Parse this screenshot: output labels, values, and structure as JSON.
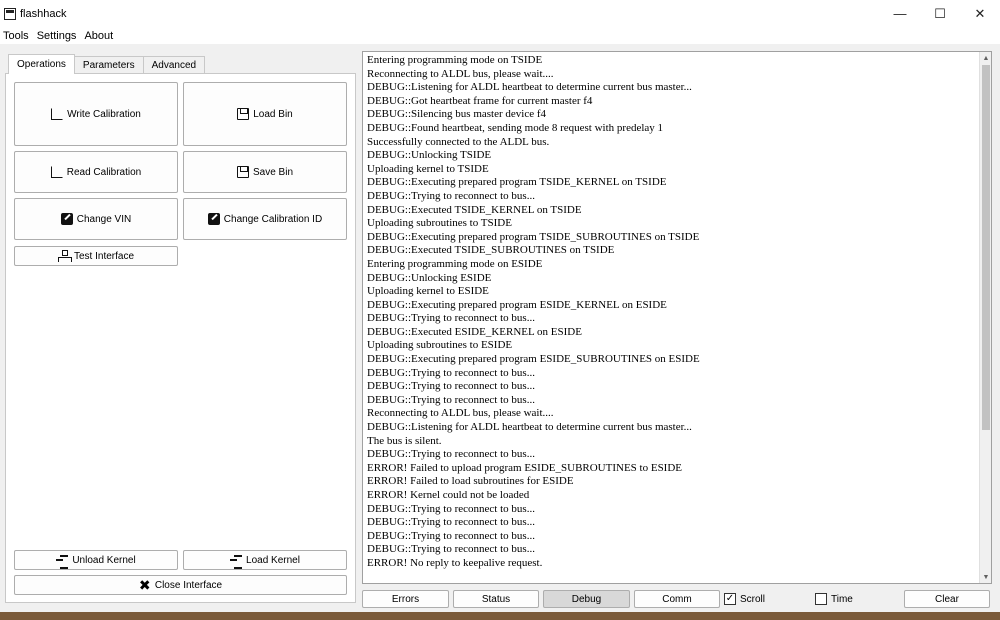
{
  "window": {
    "title": "flashhack",
    "controls": {
      "minimize": "—",
      "maximize": "☐",
      "close": "✕"
    }
  },
  "menu": [
    "Tools",
    "Settings",
    "About"
  ],
  "tabs": [
    {
      "label": "Operations",
      "active": true
    },
    {
      "label": "Parameters",
      "active": false
    },
    {
      "label": "Advanced",
      "active": false
    }
  ],
  "operations": {
    "write_calibration": "Write Calibration",
    "load_bin": "Load Bin",
    "read_calibration": "Read Calibration",
    "save_bin": "Save Bin",
    "change_vin": "Change VIN",
    "change_calibration_id": "Change Calibration ID",
    "test_interface": "Test Interface",
    "unload_kernel": "Unload Kernel",
    "load_kernel": "Load Kernel",
    "close_interface": "Close Interface"
  },
  "log": [
    "Entering programming mode on TSIDE",
    "Reconnecting to ALDL bus, please wait....",
    "DEBUG::Listening for ALDL heartbeat to determine current bus master...",
    "DEBUG::Got heartbeat frame for current master f4",
    "DEBUG::Silencing bus master device f4",
    "DEBUG::Found heartbeat, sending mode 8 request with predelay 1",
    "Successfully connected to the ALDL bus.",
    "DEBUG::Unlocking TSIDE",
    "Uploading kernel to TSIDE",
    "DEBUG::Executing prepared program TSIDE_KERNEL on TSIDE",
    "DEBUG::Trying to reconnect to bus...",
    "DEBUG::Executed TSIDE_KERNEL on TSIDE",
    "Uploading subroutines to TSIDE",
    "DEBUG::Executing prepared program TSIDE_SUBROUTINES on TSIDE",
    "DEBUG::Executed TSIDE_SUBROUTINES on TSIDE",
    "Entering programming mode on ESIDE",
    "DEBUG::Unlocking ESIDE",
    "Uploading kernel to ESIDE",
    "DEBUG::Executing prepared program ESIDE_KERNEL on ESIDE",
    "DEBUG::Trying to reconnect to bus...",
    "DEBUG::Executed ESIDE_KERNEL on ESIDE",
    "Uploading subroutines to ESIDE",
    "DEBUG::Executing prepared program ESIDE_SUBROUTINES on ESIDE",
    "DEBUG::Trying to reconnect to bus...",
    "DEBUG::Trying to reconnect to bus...",
    "DEBUG::Trying to reconnect to bus...",
    "Reconnecting to ALDL bus, please wait....",
    "DEBUG::Listening for ALDL heartbeat to determine current bus master...",
    "The bus is silent.",
    "DEBUG::Trying to reconnect to bus...",
    "ERROR! Failed to upload program ESIDE_SUBROUTINES to ESIDE",
    "ERROR! Failed to load subroutines for ESIDE",
    "ERROR! Kernel could not be loaded",
    "DEBUG::Trying to reconnect to bus...",
    "DEBUG::Trying to reconnect to bus...",
    "DEBUG::Trying to reconnect to bus...",
    "DEBUG::Trying to reconnect to bus...",
    "ERROR! No reply to keepalive request."
  ],
  "bottom": {
    "errors": "Errors",
    "status": "Status",
    "debug": "Debug",
    "comm": "Comm",
    "scroll": {
      "label": "Scroll",
      "checked": true
    },
    "time": {
      "label": "Time",
      "checked": false
    },
    "clear": "Clear"
  },
  "icons": {
    "write_calibration": "box-arrow-in-icon",
    "read_calibration": "box-arrow-out-icon",
    "load_bin": "floppy-icon",
    "save_bin": "floppy-icon",
    "change_vin": "pencil-icon",
    "change_calibration_id": "pencil-icon",
    "test_interface": "network-icon",
    "unload_kernel": "kernel-icon",
    "load_kernel": "kernel-icon",
    "close_interface": "close-plug-icon"
  }
}
